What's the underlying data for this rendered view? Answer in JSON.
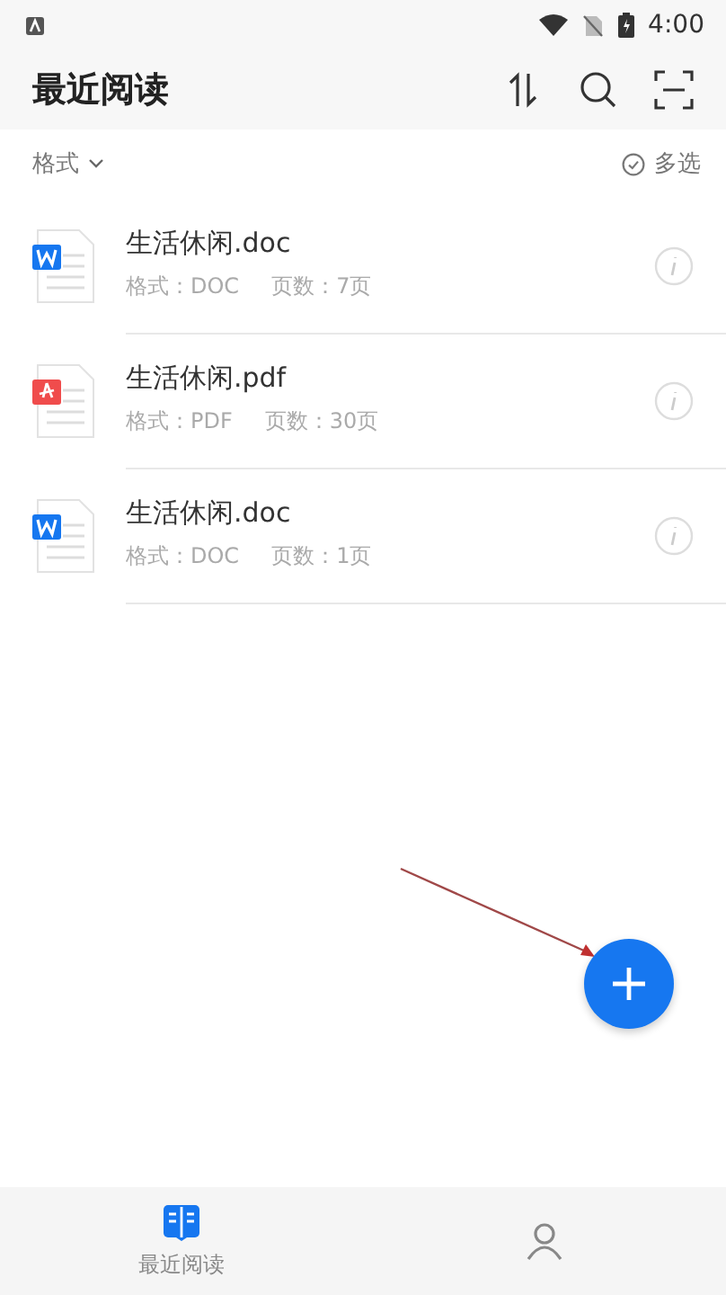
{
  "status_bar": {
    "time": "4:00"
  },
  "header": {
    "title": "最近阅读"
  },
  "filter": {
    "label": "格式",
    "multi_select": "多选"
  },
  "files": [
    {
      "name": "生活休闲.doc",
      "kind": "doc",
      "format": "格式：DOC",
      "pages": "页数：7页"
    },
    {
      "name": "生活休闲.pdf",
      "kind": "pdf",
      "format": "格式：PDF",
      "pages": "页数：30页"
    },
    {
      "name": "生活休闲.doc",
      "kind": "doc",
      "format": "格式：DOC",
      "pages": "页数：1页"
    }
  ],
  "tabs": [
    {
      "label": "最近阅读",
      "selected": true
    },
    {
      "selected": false
    }
  ]
}
